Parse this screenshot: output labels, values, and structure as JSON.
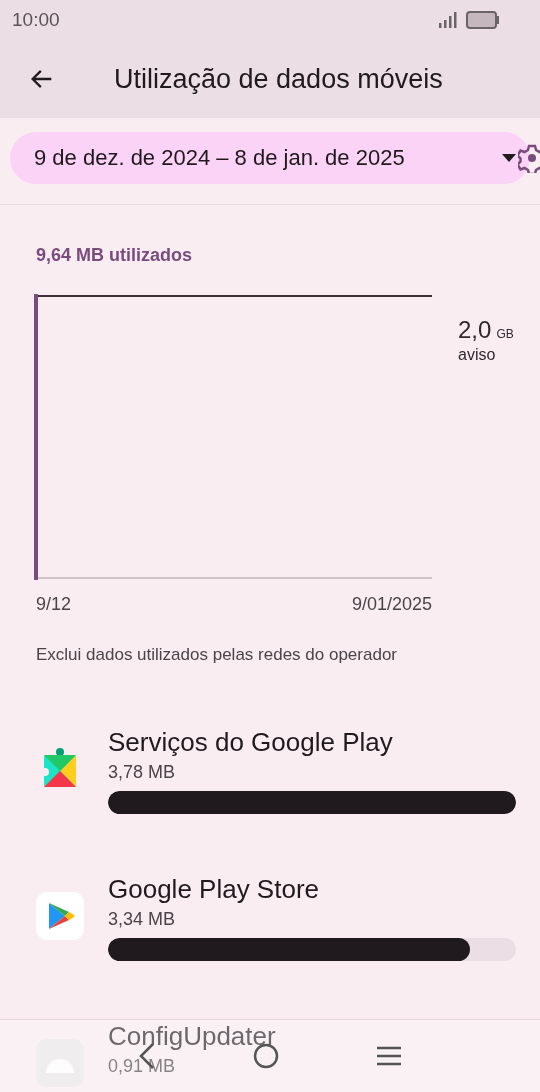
{
  "status_bar": {
    "time": "10:00"
  },
  "app_bar": {
    "title": "Utilização de dados móveis"
  },
  "period": {
    "label": "9 de dez. de 2024 – 8 de jan. de 2025"
  },
  "usage": {
    "total": "9,64 MB utilizados",
    "warning_value": "2,0",
    "warning_unit": "GB",
    "warning_label": "aviso",
    "x_start": "9/12",
    "x_end": "9/01/2025"
  },
  "note": "Exclui dados utilizados pelas redes do operador",
  "apps": [
    {
      "kind": "services",
      "name": "Serviços do Google Play",
      "size": "3,78 MB",
      "level": 1.0
    },
    {
      "kind": "store",
      "name": "Google Play Store",
      "size": "3,34 MB",
      "level": 0.887
    },
    {
      "kind": "android",
      "name": "ConfigUpdater",
      "size": "0,91 MB"
    }
  ]
}
